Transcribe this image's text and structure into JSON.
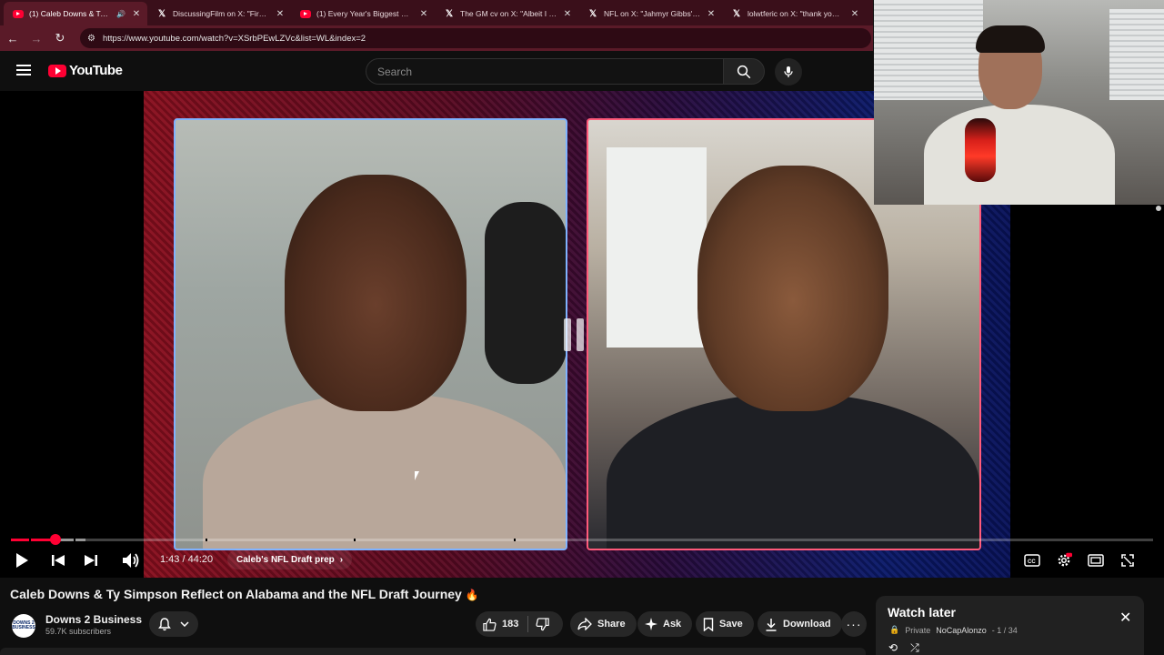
{
  "browser": {
    "tabs": [
      {
        "title": "(1) Caleb Downs & Ty Simp",
        "icon": "youtube-icon",
        "audio": true
      },
      {
        "title": "DiscussingFilm on X: \"First traile",
        "icon": "x-icon"
      },
      {
        "title": "(1) Every Year's Biggest NFL Dra",
        "icon": "youtube-icon"
      },
      {
        "title": "The GM cv on X: \"Albeit I don't",
        "icon": "x-icon"
      },
      {
        "title": "NFL on X: \"Jahmyr Gibbs' new t",
        "icon": "x-icon"
      },
      {
        "title": "lolwtferic on X: \"thank you ever",
        "icon": "x-icon"
      }
    ],
    "url": "https://www.youtube.com/watch?v=XSrbPEwLZVc&list=WL&index=2"
  },
  "header": {
    "logo_text": "YouTube",
    "search_placeholder": "Search"
  },
  "player": {
    "current_time": "1:43",
    "duration": "44:20",
    "time_display": "1:43 / 44:20",
    "progress_fraction": 0.0387,
    "chapter": "Caleb's NFL Draft prep",
    "chapter_marks": [
      0.016,
      0.055,
      0.17,
      0.3,
      0.44
    ]
  },
  "video": {
    "title": "Caleb Downs & Ty Simpson Reflect on Alabama and the NFL Draft Journey",
    "title_emoji": "🔥"
  },
  "channel": {
    "name": "Downs 2 Business",
    "subscribers": "59.7K subscribers",
    "avatar_text": "DOWNS 2 BUSINESS"
  },
  "actions": {
    "likes": "183",
    "share": "Share",
    "ask": "Ask",
    "save": "Save",
    "download": "Download"
  },
  "playlist": {
    "title": "Watch later",
    "privacy": "Private",
    "owner": "NoCapAlonzo",
    "position": "- 1 / 34"
  },
  "colors": {
    "brand_red": "#ff0033",
    "browser_frame": "#5a1a28",
    "background": "#0f0f0f"
  }
}
